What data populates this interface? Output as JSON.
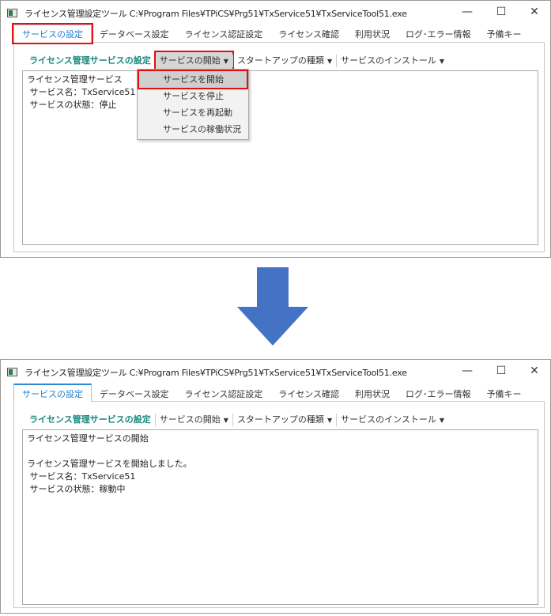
{
  "window_title": "ライセンス管理設定ツール  C:¥Program Files¥TPiCS¥Prg51¥TxService51¥TxServiceTool51.exe",
  "window_controls": {
    "minimize": "—",
    "maximize": "☐",
    "close": "✕"
  },
  "tabs": [
    "サービスの設定",
    "データベース設定",
    "ライセンス認証設定",
    "ライセンス確認",
    "利用状況",
    "ログ･エラー情報",
    "予備キー"
  ],
  "toolbar": {
    "label": "ライセンス管理サービスの設定",
    "service_start": "サービスの開始",
    "startup_type": "スタートアップの種類",
    "service_install": "サービスのインストール"
  },
  "dropdown": [
    "サービスを開始",
    "サービスを停止",
    "サービスを再起動",
    "サービスの稼働状況"
  ],
  "before": {
    "lines": [
      "ライセンス管理サービス",
      " サービス名：TxService51",
      " サービスの状態：停止"
    ]
  },
  "after": {
    "lines": [
      "ライセンス管理サービスの開始",
      "",
      "ライセンス管理サービスを開始しました。",
      " サービス名：TxService51",
      " サービスの状態：稼動中"
    ]
  },
  "colors": {
    "highlight": "#e01010",
    "accent": "#1e7fd0",
    "label": "#17897e",
    "arrow": "#4472c4"
  }
}
